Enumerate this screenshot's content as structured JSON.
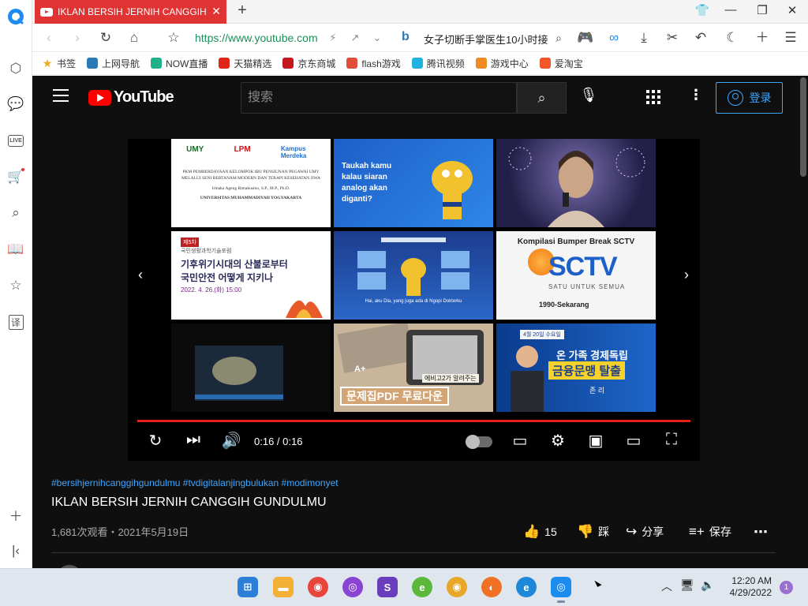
{
  "browser": {
    "tab_title": "IKLAN BERSIH JERNIH CANGGIH GU",
    "url": "https://www.youtube.com",
    "search_text": "女子切断手掌医生10小时接",
    "bookmarks": [
      {
        "label": "书签",
        "color": "#f5a623",
        "icon": "star-icon"
      },
      {
        "label": "上网导航",
        "color": "#2a7ab8",
        "icon": "ie-icon"
      },
      {
        "label": "NOW直播",
        "color": "#1fb18a",
        "icon": "now-icon"
      },
      {
        "label": "天猫精选",
        "color": "#e0261b",
        "icon": "tmall-icon"
      },
      {
        "label": "京东商城",
        "color": "#c8161d",
        "icon": "jd-icon"
      },
      {
        "label": "flash游戏",
        "color": "#e24c3a",
        "icon": "flash-icon"
      },
      {
        "label": "腾讯视频",
        "color": "#20b2e0",
        "icon": "tencent-video-icon"
      },
      {
        "label": "游戏中心",
        "color": "#f08a24",
        "icon": "game-center-icon"
      },
      {
        "label": "爱淘宝",
        "color": "#f2552c",
        "icon": "taobao-icon"
      }
    ]
  },
  "youtube": {
    "search_placeholder": "搜索",
    "login_label": "登录",
    "logo_text": "YouTube",
    "thumbs": {
      "t1_heading": "PKM PEMBERDAYAAN KELOMPOK IBU PENSIUNAN PEGAWAI UMY MELALUI SENI BERTANAM MODERN DAN TERAPI KESEHATAN JIWA",
      "t1_author": "Irmaka Ageng Rimakusmo, S.P., M.P., Ph.D.",
      "t1_univ": "UNIVERSITAS MUHAMMADIYAH YOGYAKARTA",
      "t1_logo_a": "UMY",
      "t1_logo_b": "LPM",
      "t1_logo_c": "Kampus Merdeka",
      "t2_text": "Taukah kamu kalau siaran analog akan diganti?",
      "t4_text_1": "기후위기시대의 산불로부터",
      "t4_text_2": "국민안전 어떻게 지키나",
      "t4_date": "2022. 4. 26.(화) 15:00",
      "t4_tag": "제5차",
      "t4_org": "국민생활과학기술포럼",
      "t5_caption": "Hai, aku Dia, yang juga ada di Ngopi Dokterku",
      "t6_title": "Kompilasi Bumper Break SCTV",
      "t6_logo": "SCTV",
      "t6_slogan": "SATU UNTUK SEMUA",
      "t6_years": "1990-Sekarang",
      "t8_text": "문제집PDF 무료다운",
      "t8_sub": "에비고2가 알려주는",
      "t8_grade": "A+",
      "t9_text_1": "온 가족 경제독립",
      "t9_text_2": "금융문맹 탈출",
      "t9_date": "4월 20일 수요일",
      "t9_name": "존 리"
    },
    "player": {
      "time": "0:16 / 0:16",
      "progress": 1.0
    },
    "video": {
      "hashtags": "#bersihjernihcanggihgundulmu #tvdigitalanjingbulukan #modimonyet",
      "title": "IKLAN BERSIH JERNIH CANGGIH GUNDULMU",
      "views": "1,681次观看・2021年5月19日",
      "likes": "15",
      "dislike_label": "踩",
      "share_label": "分享",
      "save_label": "保存"
    }
  },
  "taskbar": {
    "time": "12:20 AM",
    "date": "4/29/2022",
    "notifications": "1"
  }
}
